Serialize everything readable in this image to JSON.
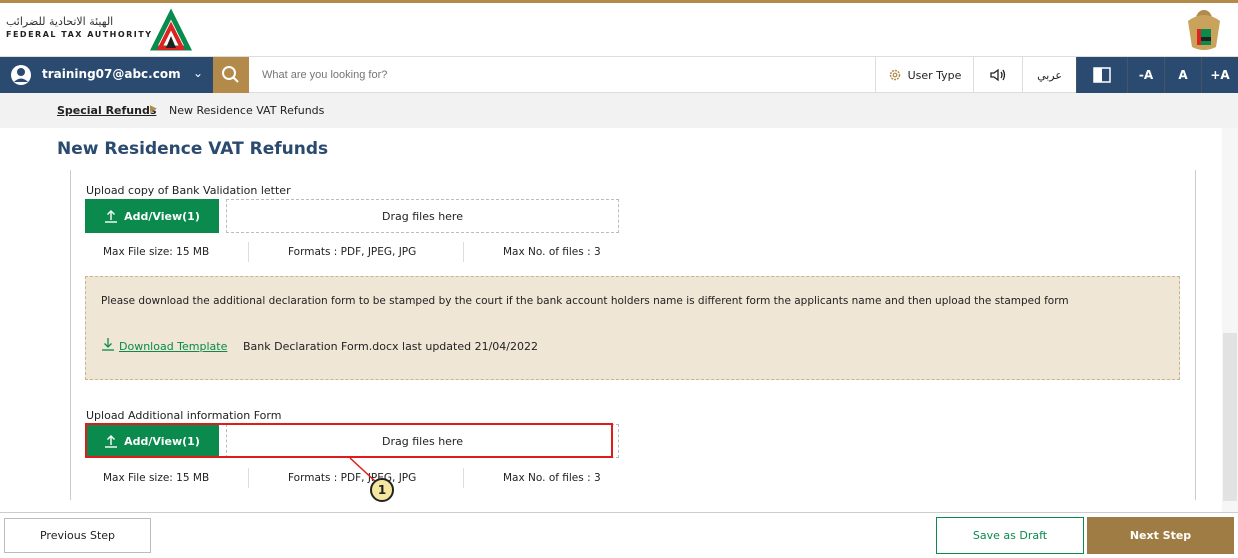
{
  "header": {
    "logo_arabic": "الهيئة الاتحادية للضرائب",
    "logo_english": "FEDERAL TAX AUTHORITY"
  },
  "navbar": {
    "user_email": "training07@abc.com",
    "search_placeholder": "What are you looking for?",
    "user_type_label": "User Type",
    "language_label": "عربي",
    "font_decrease": "-A",
    "font_normal": "A",
    "font_increase": "+A"
  },
  "breadcrumb": {
    "parent": "Special Refunds",
    "current": "New Residence VAT Refunds"
  },
  "page_title": "New Residence VAT Refunds",
  "uploads": [
    {
      "label": "Upload copy of Bank Validation letter",
      "button": "Add/View(1)",
      "drop_text": "Drag files here",
      "max_size": "Max File size: 15 MB",
      "formats": "Formats : PDF, JPEG, JPG",
      "max_files": "Max No. of files : 3"
    },
    {
      "label": "Upload Additional information Form",
      "button": "Add/View(1)",
      "drop_text": "Drag files here",
      "max_size": "Max File size: 15 MB",
      "formats": "Formats : PDF, JPEG, JPG",
      "max_files": "Max No. of files : 3"
    }
  ],
  "notice": {
    "text": "Please download the additional declaration form to be stamped by the court if the bank account holders name is different form the applicants name and then upload the stamped form",
    "download_link": "Download Template",
    "file_meta": "Bank Declaration Form.docx last updated 21/04/2022"
  },
  "callout_number": "1",
  "footer": {
    "previous": "Previous Step",
    "save_draft": "Save as Draft",
    "next": "Next Step"
  },
  "colors": {
    "navy": "#2b4a6f",
    "gold": "#b48a4a",
    "green": "#0a8a4c",
    "highlight_red": "#e01b1b"
  }
}
